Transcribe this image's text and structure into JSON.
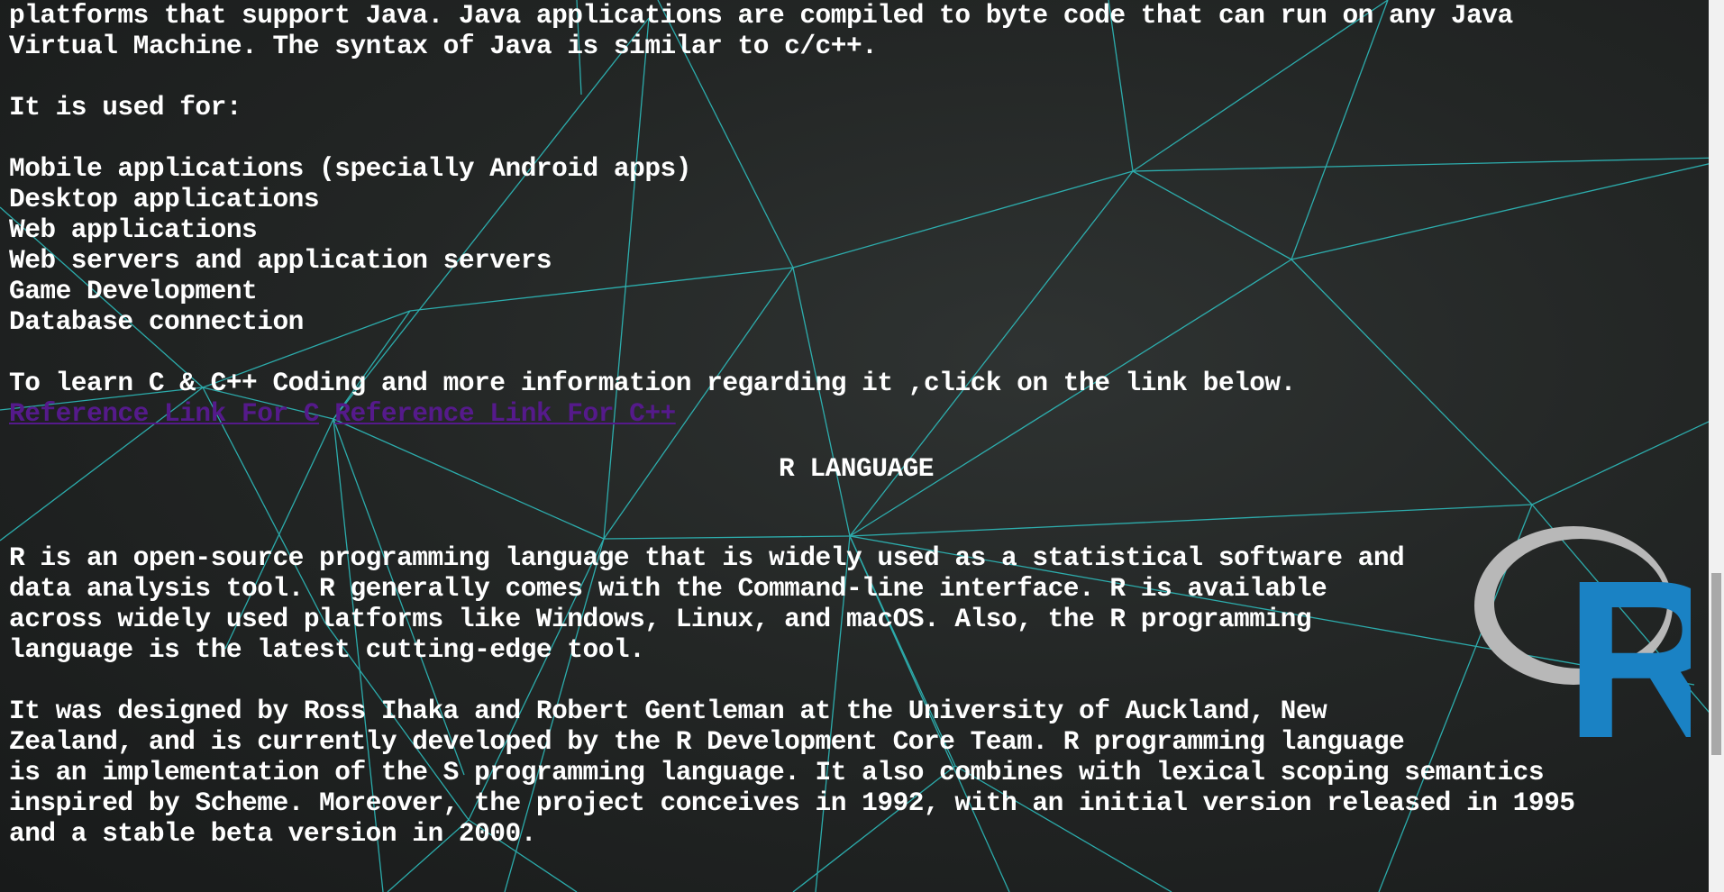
{
  "intro_lines": [
    "platforms that support Java. Java applications are compiled to byte code that can run on any Java",
    "Virtual Machine. The syntax of Java is similar to c/c++."
  ],
  "used_for_heading": "It is used for:",
  "used_for_items": [
    "Mobile applications (specially Android apps)",
    "Desktop applications",
    "Web applications",
    "Web servers and application servers",
    "Game Development",
    "Database connection"
  ],
  "learn_text": "To learn C & C++ Coding and more information regarding it ,click on the link below.",
  "links": {
    "c_label": "Reference Link For C",
    "cpp_label": "Reference Link For C++"
  },
  "section_title": "R LANGUAGE",
  "r_para1": [
    "R is an open-source programming language that is widely used as a statistical software and",
    "data analysis tool. R generally comes with the Command-line interface. R is available",
    "across widely used platforms like Windows, Linux, and macOS. Also, the R programming",
    "language is the latest cutting-edge tool."
  ],
  "r_para2": [
    "It was designed by Ross Ihaka and Robert Gentleman at the University of Auckland, New",
    "Zealand, and is currently developed by the R Development Core Team. R programming language",
    "is an implementation of the S programming language. It also combines with lexical scoping semantics",
    "inspired by Scheme. Moreover, the project conceives in 1992, with an initial version released in 1995",
    "and a stable beta version in 2000."
  ],
  "logo": {
    "letter": "R",
    "ring_color": "#b8b8b8",
    "letter_color": "#1a82c4"
  },
  "colors": {
    "mesh": "#2ec4c4",
    "link": "#551a8b",
    "text": "#ffffff"
  }
}
